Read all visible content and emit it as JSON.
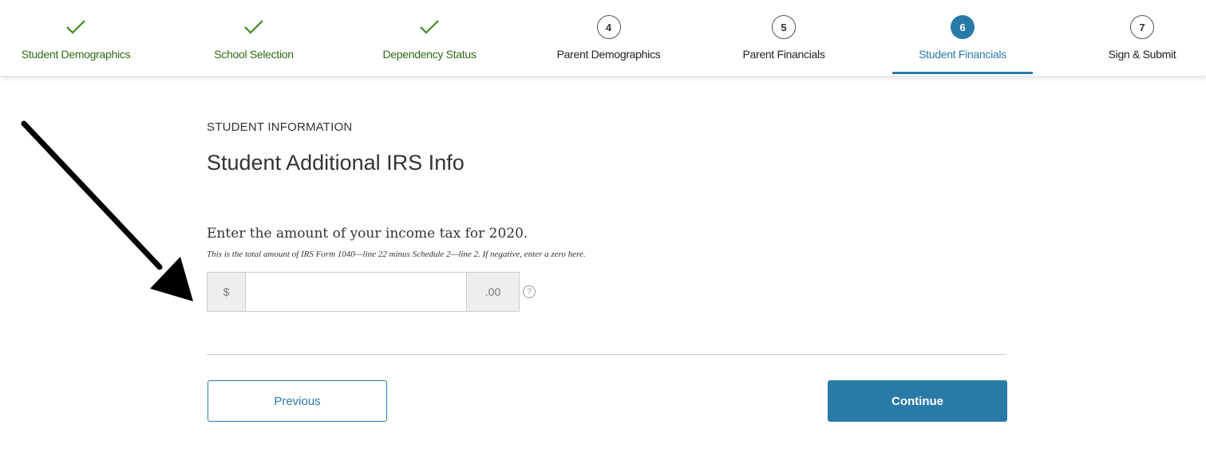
{
  "steps": [
    {
      "label": "Student Demographics",
      "status": "complete",
      "icon": "check-icon"
    },
    {
      "label": "School Selection",
      "status": "complete",
      "icon": "check-icon"
    },
    {
      "label": "Dependency Status",
      "status": "complete",
      "icon": "check-icon"
    },
    {
      "number": "4",
      "label": "Parent Demographics",
      "status": "incomplete"
    },
    {
      "number": "5",
      "label": "Parent Financials",
      "status": "incomplete"
    },
    {
      "number": "6",
      "label": "Student Financials",
      "status": "current"
    },
    {
      "number": "7",
      "label": "Sign & Submit",
      "status": "incomplete"
    }
  ],
  "header": {
    "section_label": "STUDENT INFORMATION",
    "title": "Student Additional IRS Info"
  },
  "form": {
    "question": "Enter the amount of your income tax for 2020.",
    "hint": "This is the total amount of IRS Form 1040—line 22 minus Schedule 2—line 2. If negative, enter a zero here.",
    "currency_prefix": "$",
    "cents_suffix": ".00",
    "value": "",
    "help_glyph": "?"
  },
  "buttons": {
    "previous": "Previous",
    "continue": "Continue"
  },
  "colors": {
    "accent": "#2a7aa8",
    "complete_green": "#2e6b14"
  }
}
